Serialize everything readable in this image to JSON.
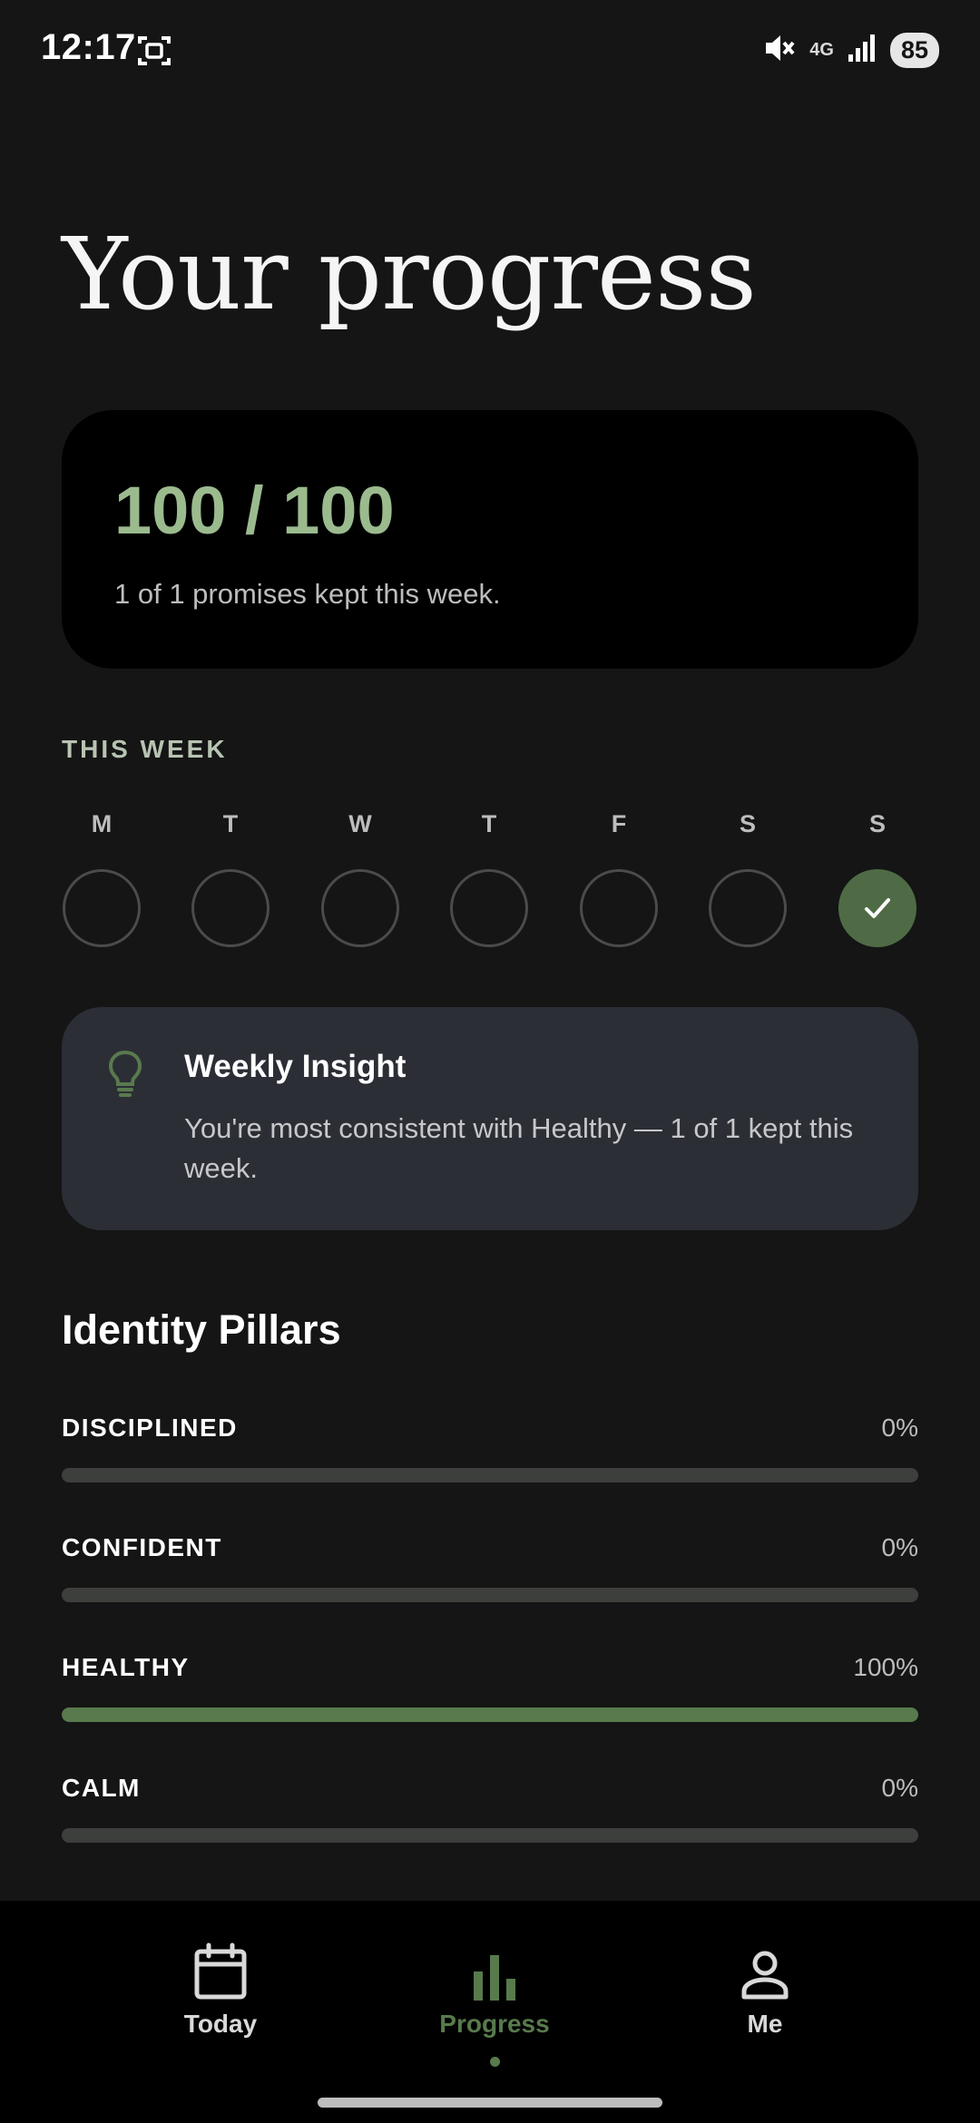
{
  "status_bar": {
    "time": "12:17",
    "network": "4G",
    "battery": "85"
  },
  "page": {
    "title": "Your progress"
  },
  "score": {
    "value": "100 / 100",
    "subtitle": "1 of 1 promises kept this week."
  },
  "week": {
    "label": "THIS WEEK",
    "days": [
      {
        "letter": "M",
        "done": false
      },
      {
        "letter": "T",
        "done": false
      },
      {
        "letter": "W",
        "done": false
      },
      {
        "letter": "T",
        "done": false
      },
      {
        "letter": "F",
        "done": false
      },
      {
        "letter": "S",
        "done": false
      },
      {
        "letter": "S",
        "done": true
      }
    ]
  },
  "insight": {
    "icon": "lightbulb-icon",
    "title": "Weekly Insight",
    "text": "You're most consistent with Healthy — 1 of 1 kept this week."
  },
  "pillars": {
    "title": "Identity Pillars",
    "items": [
      {
        "name": "DISCIPLINED",
        "percent_label": "0%",
        "progress": 0
      },
      {
        "name": "CONFIDENT",
        "percent_label": "0%",
        "progress": 0
      },
      {
        "name": "HEALTHY",
        "percent_label": "100%",
        "progress": 100
      },
      {
        "name": "CALM",
        "percent_label": "0%",
        "progress": 0
      }
    ]
  },
  "nav": {
    "items": [
      {
        "label": "Today",
        "icon": "calendar-icon",
        "active": false
      },
      {
        "label": "Progress",
        "icon": "bar-chart-icon",
        "active": true
      },
      {
        "label": "Me",
        "icon": "person-icon",
        "active": false
      }
    ]
  },
  "colors": {
    "background": "#141514",
    "accent_green": "#587a4d",
    "score_green": "#9bbb8e",
    "insight_card": "#2c2e36"
  }
}
